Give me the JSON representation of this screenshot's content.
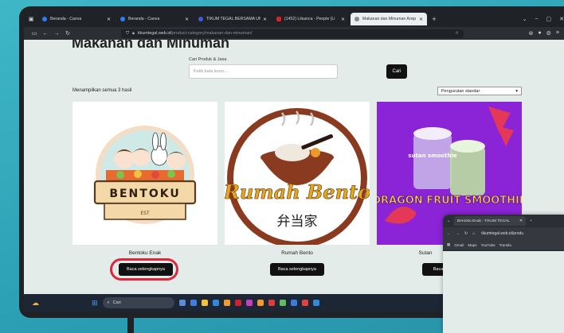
{
  "browser": {
    "tabs": [
      {
        "label": "Beranda - Canva",
        "color": "#2f7cf6",
        "active": false
      },
      {
        "label": "Beranda - Canva",
        "color": "#2f7cf6",
        "active": false
      },
      {
        "label": "TIKUM TEGAL BERSAMA UMKM",
        "color": "#3c5be0",
        "active": false
      },
      {
        "label": "(1452) Lilsanca - People (Li",
        "color": "#e02020",
        "active": false
      },
      {
        "label": "Makanan dan Minuman Arsip",
        "color": "#888888",
        "active": true
      }
    ],
    "url_host": "tikumtegal.web.id",
    "url_path": "/product-category/makanan-dan-minuman/"
  },
  "page": {
    "title": "Makanan dan Minuman",
    "search_label": "Cari Produk & Jasa",
    "search_placeholder": "Ketik kata kunci...",
    "search_button": "Cari",
    "results_text": "Menampilkan semua 3 hasil",
    "sort_value": "Pengurutan standar",
    "products": [
      {
        "name": "Bentoku Enak",
        "button": "Baca selengkapnya",
        "logo_text": "BENTOKU",
        "logo_sub": "EST"
      },
      {
        "name": "Rumah Bento",
        "button": "Baca selengkapnya",
        "logo_text": "Rumah Bento",
        "logo_sub": "弁当家"
      },
      {
        "name": "Sutan",
        "button": "Baca",
        "logo_text": "DRAGON FRUIT SMOOTHIE",
        "logo_sub": "sutan smoothie"
      }
    ]
  },
  "taskbar": {
    "search_text": "Cari"
  },
  "inset": {
    "tab_label": "Bentoku Enak - TIKUM TEGAL",
    "url": "tikumtegal.web.id/produ",
    "bookmarks": [
      "Gmail",
      "Maps",
      "YouTube",
      "Transla"
    ]
  },
  "colors": {
    "frame": "#2b9fb4",
    "highlight": "#e0263d",
    "page_bg": "#e3ece8",
    "button": "#111111"
  }
}
